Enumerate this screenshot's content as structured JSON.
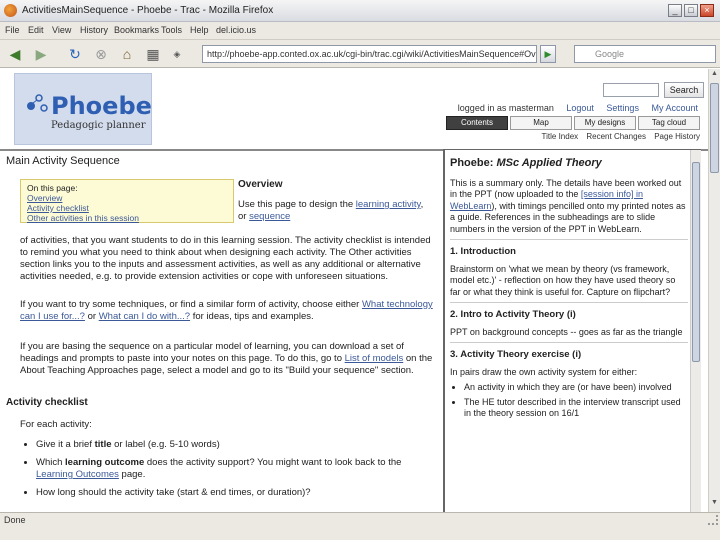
{
  "window": {
    "title": "ActivitiesMainSequence - Phoebe - Trac - Mozilla Firefox",
    "minimize": "_",
    "maximize": "□",
    "close": "×"
  },
  "menubar": [
    "File",
    "Edit",
    "View",
    "History",
    "Bookmarks",
    "Tools",
    "Help",
    "del.icio.us"
  ],
  "navbar": {
    "url": "http://phoebe-app.conted.ox.ac.uk/cgi-bin/trac.cgi/wiki/ActivitiesMainSequence#Overview",
    "go": "▶",
    "search_placeholder": "Google",
    "search_engine": "G"
  },
  "site": {
    "logo_title": "Phoebe",
    "logo_subtitle": "Pedagogic planner",
    "search_button": "Search",
    "logged_in": "logged in as masterman",
    "logout": "Logout",
    "settings": "Settings",
    "my_account": "My Account",
    "tabs": [
      "Contents",
      "Map",
      "My designs",
      "Tag cloud"
    ],
    "subnav": [
      "Title Index",
      "Recent Changes",
      "Page History"
    ]
  },
  "main": {
    "title": "Main Activity Sequence",
    "toc_heading": "On this page:",
    "toc_items": [
      "Overview",
      "Activity checklist",
      "Other activities in this session"
    ],
    "overview_title": "Overview",
    "overview_p1a": "Use this page to design the ",
    "overview_link1": "learning activity",
    "overview_p1b": ", or ",
    "overview_link2": "sequence",
    "overview_p1c": " of activities, that you want students to do in this learning session. The activity checklist is intended to remind you what you need to think about when designing each activity. The Other activities section links you to the inputs and assessment activities, as well as any additional or alternative activities needed, e.g. to provide extension activities or cope with unforeseen situations.",
    "overview_p2a": "If you want to try some techniques, or find a similar form of activity, choose either ",
    "overview_link3": "What technology can I use for...?",
    "overview_p2b": " or ",
    "overview_link4": "What can I do with...?",
    "overview_p2c": " for ideas, tips and examples.",
    "overview_p3a": "If you are basing the sequence on a particular model of learning, you can download a set of headings and prompts to paste into your notes on this page. To do this, go to ",
    "overview_link5": "List of models",
    "overview_p3b": " on the About Teaching Approaches page, select a model and go to its \"Build your sequence\" section.",
    "checklist_title": "Activity checklist",
    "checklist_intro": "For each activity:",
    "checklist_1a": "Give it a brief ",
    "checklist_1b": "title",
    "checklist_1c": " or label (e.g. 5-10 words)",
    "checklist_2a": "Which ",
    "checklist_2b": "learning outcome",
    "checklist_2c": " does the activity support? You might want to look back to the ",
    "checklist_2link": "Learning Outcomes",
    "checklist_2d": " page.",
    "checklist_3": "How long should the activity take (start & end times, or duration)?"
  },
  "panel": {
    "title_a": "Phoebe: ",
    "title_b": "MSc Applied Theory",
    "intro_a": "This is a summary only. The details have been worked out in the PPT (now uploaded to the ",
    "intro_link": "[session info] in WebLearn",
    "intro_b": "), with timings pencilled onto my printed notes as a guide. References in the subheadings are to slide numbers in the version of the PPT in WebLearn.",
    "h1": "1. Introduction",
    "p1": "Brainstorm on 'what we mean by theory (vs framework, model etc.)' - reflection on how they have used theory so far or what they think is useful for. Capture on flipchart?",
    "h2": "2. Intro to Activity Theory (i)",
    "p2": "PPT on background concepts -- goes as far as the triangle",
    "h3": "3. Activity Theory exercise (i)",
    "p3": "In pairs draw the own activity system for either:",
    "li1": "An activity in which they are (or have been) involved",
    "li2": "The HE tutor described in the interview transcript used in the theory session on 16/1"
  },
  "status": {
    "text": "Done"
  }
}
